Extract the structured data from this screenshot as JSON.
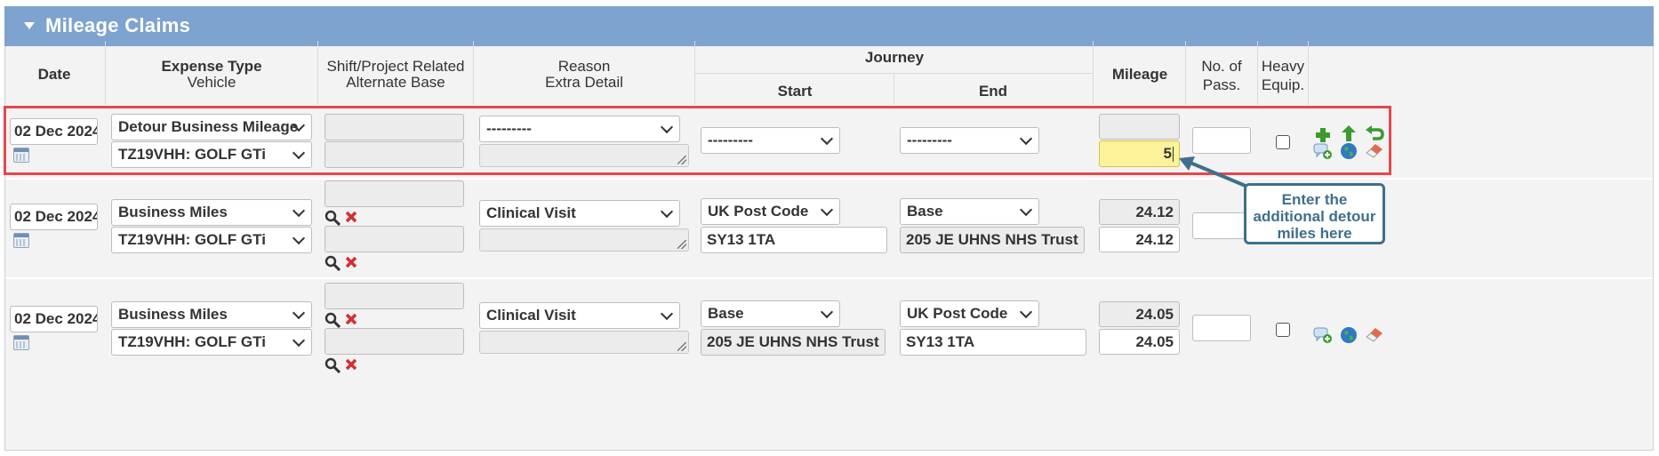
{
  "panel": {
    "title": "Mileage Claims"
  },
  "headers": {
    "date": "Date",
    "expense_type": "Expense Type",
    "vehicle": "Vehicle",
    "shift_project": "Shift/Project Related",
    "alternate_base": "Alternate Base",
    "reason": "Reason",
    "extra_detail": "Extra Detail",
    "journey": "Journey",
    "start": "Start",
    "end": "End",
    "mileage": "Mileage",
    "passengers_1": "No. of",
    "passengers_2": "Pass.",
    "heavy_1": "Heavy",
    "heavy_2": "Equip."
  },
  "rows": [
    {
      "date": "02 Dec 2024",
      "expense_type": "Detour Business Mileage",
      "vehicle": "TZ19VHH: GOLF GTi",
      "reason": "---------",
      "start_type": "---------",
      "end_type": "---------",
      "mileage_input": "5"
    },
    {
      "date": "02 Dec 2024",
      "expense_type": "Business Miles",
      "vehicle": "TZ19VHH: GOLF GTi",
      "reason": "Clinical Visit",
      "start_type": "UK Post Code",
      "start_value": "SY13 1TA",
      "end_type": "Base",
      "end_value": "205 JE UHNS NHS Trust",
      "mileage_calc": "24.12",
      "mileage_input": "24.12"
    },
    {
      "date": "02 Dec 2024",
      "expense_type": "Business Miles",
      "vehicle": "TZ19VHH: GOLF GTi",
      "reason": "Clinical Visit",
      "start_type": "Base",
      "start_value": "205 JE UHNS NHS Trust",
      "end_type": "UK Post Code",
      "end_value": "SY13 1TA",
      "mileage_calc": "24.05",
      "mileage_input": "24.05"
    }
  ],
  "callout": {
    "text": "Enter the additional detour miles here"
  },
  "colors": {
    "title_bar": "#7ea3cf",
    "highlight_box": "#e4484d",
    "callout_border": "#3f6f8c",
    "active_field": "#fbf29a"
  }
}
